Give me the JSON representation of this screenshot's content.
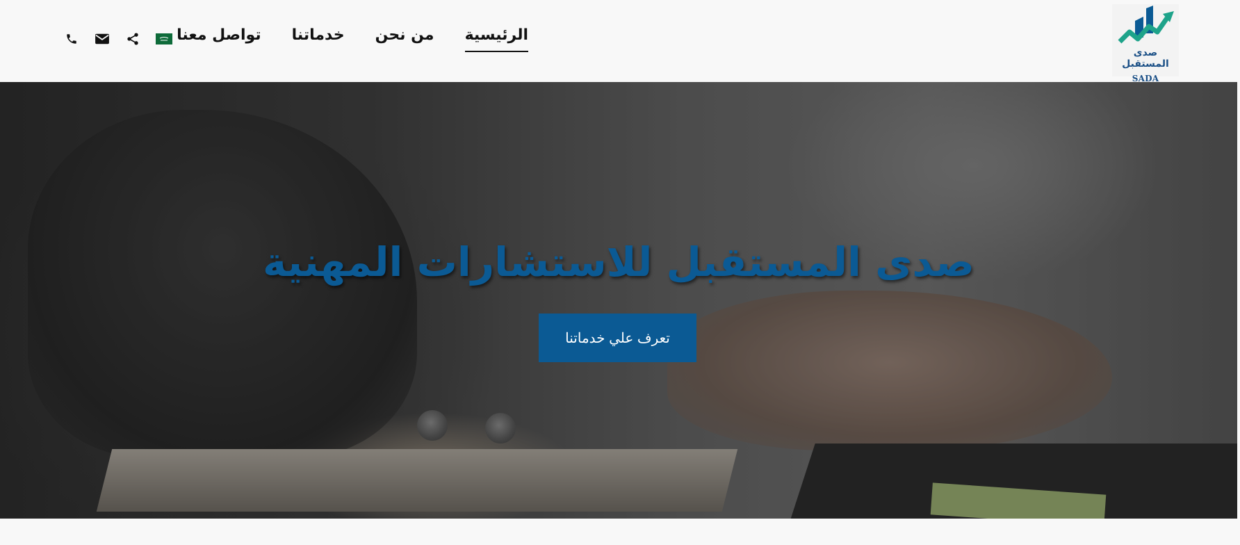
{
  "brand": {
    "name_ar": "صدى المستقبل",
    "name_en": "SADA FUTURE",
    "colors": {
      "primary": "#0b5a94",
      "green": "#1ea38a"
    }
  },
  "nav": {
    "items": [
      {
        "label": "الرئيسية",
        "active": true
      },
      {
        "label": "من نحن",
        "active": false
      },
      {
        "label": "خدماتنا",
        "active": false
      },
      {
        "label": "تواصل معنا",
        "active": false
      }
    ]
  },
  "toolbar": {
    "icons": [
      "saudi-flag-icon",
      "share-icon",
      "envelope-icon",
      "phone-icon"
    ]
  },
  "hero": {
    "title": "صدى المستقبل للاستشارات المهنية",
    "cta_label": "تعرف علي خدماتنا"
  }
}
